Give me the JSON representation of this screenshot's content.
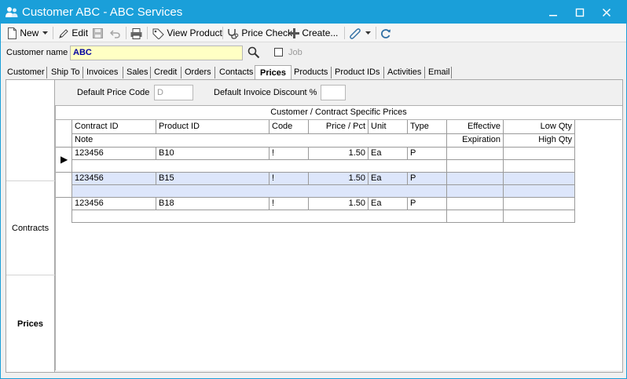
{
  "window": {
    "title": "Customer ABC - ABC Services",
    "minimize_glyph": "🗕",
    "maximize_glyph": "☐",
    "close_glyph": "✕",
    "title_bar_color": "#1a9fd9"
  },
  "toolbar": {
    "new_label": "New",
    "edit_label": "Edit",
    "view_product_label": "View Product",
    "price_check_label": "Price Check",
    "create_label": "Create...",
    "icons": [
      "new-document-icon",
      "dropdown-arrow-icon",
      "pencil-icon",
      "save-icon",
      "undo-icon",
      "print-icon",
      "tag-icon",
      "stethoscope-icon",
      "plus-icon",
      "paperclip-icon",
      "dropdown-arrow-icon",
      "refresh-icon"
    ]
  },
  "customer": {
    "label": "Customer name",
    "value": "ABC",
    "job_label": "Job",
    "job_checked": false
  },
  "tabs": [
    {
      "label": "Customer",
      "active": false
    },
    {
      "label": "Ship To",
      "active": false
    },
    {
      "label": "Invoices",
      "active": false
    },
    {
      "label": "Sales",
      "active": false
    },
    {
      "label": "Credit",
      "active": false
    },
    {
      "label": "Orders",
      "active": false
    },
    {
      "label": "Contacts",
      "active": false
    },
    {
      "label": "Prices",
      "active": true
    },
    {
      "label": "Products",
      "active": false
    },
    {
      "label": "Product IDs",
      "active": false
    },
    {
      "label": "Activities",
      "active": false
    },
    {
      "label": "Email",
      "active": false
    }
  ],
  "left_panel": {
    "contracts_label": "Contracts",
    "prices_label": "Prices"
  },
  "prices": {
    "default_price_code_label": "Default Price Code",
    "default_price_code_value": "D",
    "default_invoice_discount_label": "Default Invoice Discount %",
    "default_invoice_discount_value": "",
    "grid_title": "Customer / Contract Specific  Prices",
    "columns": {
      "contract_id": "Contract ID",
      "product_id": "Product ID",
      "code": "Code",
      "price_pct": "Price / Pct",
      "unit": "Unit",
      "type": "Type",
      "effective": "Effective",
      "low_qty": "Low Qty",
      "note": "Note",
      "expiration": "Expiration",
      "high_qty": "High Qty"
    },
    "rows": [
      {
        "contract_id": "123456",
        "product_id": "B10",
        "code": "!",
        "price": "1.50",
        "unit": "Ea",
        "type": "P",
        "effective": "",
        "low_qty": "",
        "note": "",
        "expiration": "",
        "high_qty": "",
        "current": true,
        "selected": false
      },
      {
        "contract_id": "123456",
        "product_id": "B15",
        "code": "!",
        "price": "1.50",
        "unit": "Ea",
        "type": "P",
        "effective": "",
        "low_qty": "",
        "note": "",
        "expiration": "",
        "high_qty": "",
        "current": false,
        "selected": true
      },
      {
        "contract_id": "123456",
        "product_id": "B18",
        "code": "!",
        "price": "1.50",
        "unit": "Ea",
        "type": "P",
        "effective": "",
        "low_qty": "",
        "note": "",
        "expiration": "",
        "high_qty": "",
        "current": false,
        "selected": false
      }
    ],
    "row_pointer_glyph": "▶",
    "selected_row_color": "#dde6fb"
  }
}
